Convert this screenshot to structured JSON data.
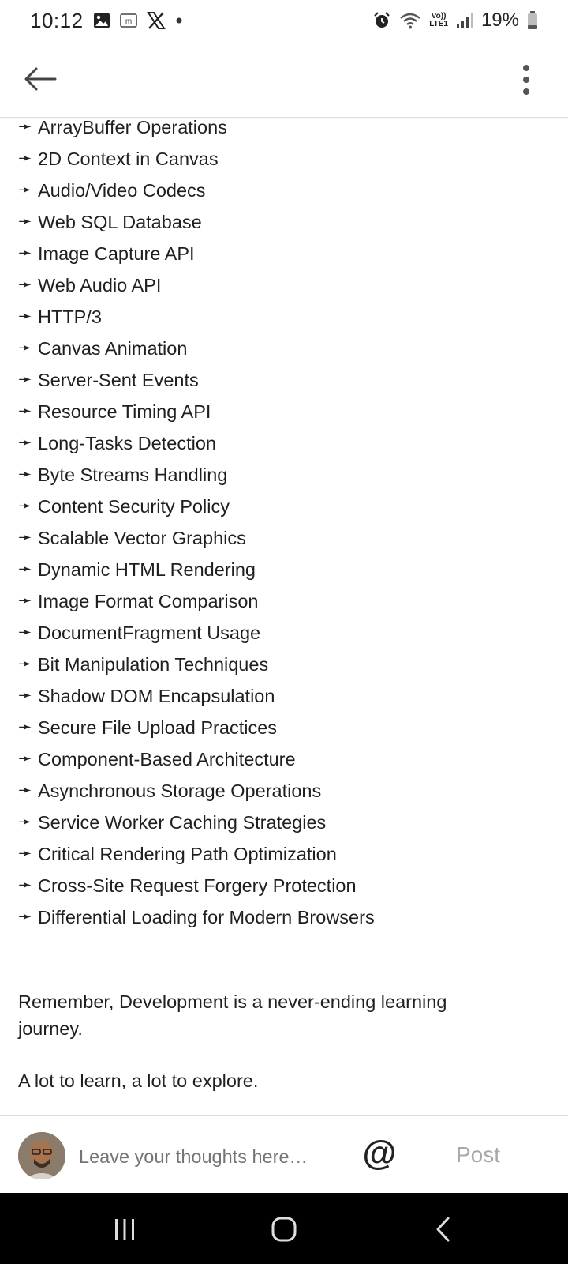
{
  "status_bar": {
    "time": "10:12",
    "left_icons": [
      "gallery-icon",
      "m-app-icon",
      "x-app-icon",
      "dot-icon"
    ],
    "right_icons": [
      "alarm-icon",
      "wifi-icon",
      "volte-lte-icon",
      "signal-icon",
      "battery-icon"
    ],
    "lte_top": "Vo))",
    "lte_bottom": "LTE1",
    "battery_text": "19%"
  },
  "app_bar": {
    "back_icon": "arrow-left-icon",
    "more_icon": "more-vertical-icon"
  },
  "content": {
    "bullet": "➛",
    "items": [
      "ArrayBuffer Operations",
      "2D Context in Canvas",
      "Audio/Video Codecs",
      "Web SQL Database",
      "Image Capture API",
      "Web Audio API",
      "HTTP/3",
      "Canvas Animation",
      "Server-Sent Events",
      "Resource Timing API",
      "Long-Tasks Detection",
      "Byte Streams Handling",
      "Content Security Policy",
      "Scalable Vector Graphics",
      "Dynamic HTML Rendering",
      "Image Format Comparison",
      "DocumentFragment Usage",
      "Bit Manipulation Techniques",
      "Shadow DOM Encapsulation",
      "Secure File Upload Practices",
      "Component-Based Architecture",
      "Asynchronous Storage Operations",
      "Service Worker Caching Strategies",
      "Critical Rendering Path Optimization",
      "Cross-Site Request Forgery Protection",
      "Differential Loading for Modern Browsers"
    ],
    "paragraph_1": "Remember, Development is a never-ending learning journey.",
    "paragraph_2": "A lot to learn, a lot to explore."
  },
  "comment_bar": {
    "placeholder": "Leave your thoughts here…",
    "mention_label": "@",
    "post_label": "Post"
  },
  "nav_bar": {
    "icons": [
      "recents-icon",
      "home-icon",
      "back-icon"
    ]
  }
}
